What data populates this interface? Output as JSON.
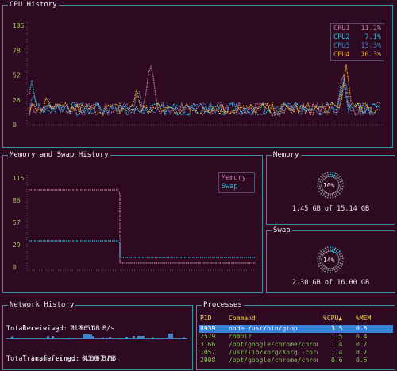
{
  "cpu": {
    "title": "CPU History",
    "y_ticks": [
      "105",
      "78",
      "52",
      "26",
      "0"
    ],
    "legend": [
      {
        "name": "CPU1",
        "value": "11.2%",
        "color": "#c67fa5"
      },
      {
        "name": "CPU2",
        "value": "7.1%",
        "color": "#33c0d6"
      },
      {
        "name": "CPU3",
        "value": "13.3%",
        "color": "#3f86c8"
      },
      {
        "name": "CPU4",
        "value": "10.3%",
        "color": "#f0a91f"
      }
    ]
  },
  "memory_history": {
    "title": "Memory and Swap History",
    "y_ticks": [
      "115",
      "86",
      "57",
      "29",
      "0"
    ],
    "legend": [
      {
        "name": "Memory",
        "color": "#c67fa5"
      },
      {
        "name": "Swap",
        "color": "#33c0d6"
      }
    ]
  },
  "memory": {
    "title": "Memory",
    "percent": "10%",
    "percent_value": 10,
    "text": "1.45 GB of 15.14 GB"
  },
  "swap": {
    "title": "Swap",
    "percent": "14%",
    "percent_value": 14,
    "text": "2.30 GB of 16.00 GB"
  },
  "network": {
    "title": "Network History",
    "receiving_label": "Receiving:",
    "receiving_value": "219.61  B/s",
    "total_received": "Total received: 1.50 GB:",
    "transferring_label": "Transferring:",
    "transferring_value": "0.00 B/s",
    "total_transferred": "Total transferred: 41.67 MB:"
  },
  "processes": {
    "title": "Processes",
    "headers": {
      "pid": "PID",
      "command": "Command",
      "cpu": "%CPU▲",
      "mem": "%MEM"
    },
    "rows": [
      {
        "pid": "8939",
        "command": "node /usr/bin/gtop",
        "cpu": "3.5",
        "mem": "0.5"
      },
      {
        "pid": "2579",
        "command": "compiz",
        "cpu": "1.5",
        "mem": "0.4"
      },
      {
        "pid": "3166",
        "command": "/opt/google/chrome/chrom",
        "cpu": "1.4",
        "mem": "0.7"
      },
      {
        "pid": "1057",
        "command": "/usr/lib/xorg/Xorg -core",
        "cpu": "1.4",
        "mem": "0.7"
      },
      {
        "pid": "2908",
        "command": "/opt/google/chrome/chrom",
        "cpu": "0.6",
        "mem": "0.6"
      }
    ]
  }
}
